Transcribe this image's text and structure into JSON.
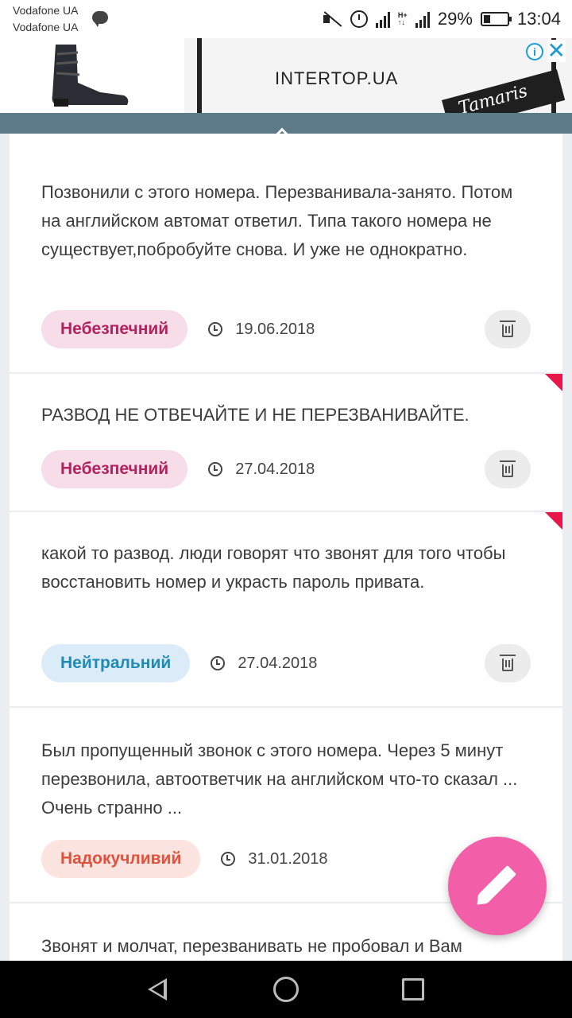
{
  "status_bar": {
    "carrier_1": "Vodafone UA",
    "carrier_2": "Vodafone UA",
    "battery": "29%",
    "time": "13:04",
    "icons": [
      "message-icon",
      "mute-icon",
      "alarm-icon",
      "signal-icon",
      "hplus-icon",
      "battery-icon"
    ]
  },
  "ad": {
    "brand": "INTERTOP.UA",
    "sub_brand": "Tamaris",
    "info_icon": "info-icon",
    "close_label": "✕"
  },
  "header": {
    "collapse_icon": "chevron-up-icon"
  },
  "reviews": [
    {
      "text": "Позвонили с этого номера. Перезванивала-занято. Потом на английском автомат ответил. Типа такого номера не существует,побробуйте снова. И уже не однократно.",
      "badge": "Небезпечний",
      "badge_type": "danger",
      "date": "19.06.2018",
      "flag": false
    },
    {
      "text": "РАЗВОД НЕ ОТВЕЧАЙТЕ И НЕ ПЕРЕЗВАНИВАЙТЕ.",
      "badge": "Небезпечний",
      "badge_type": "danger",
      "date": "27.04.2018",
      "flag": true
    },
    {
      "text": "какой то развод. люди говорят что звонят для того чтобы восстановить номер и украсть пароль привата.",
      "badge": "Нейтральний",
      "badge_type": "neutral",
      "date": "27.04.2018",
      "flag": true
    },
    {
      "text": "Был пропущенный звонок с этого номера. Через 5 минут перезвонила, автоответчик на английском что-то сказал ... Очень странно ...",
      "badge": "Надокучливий",
      "badge_type": "annoy",
      "date": "31.01.2018",
      "flag": false
    },
    {
      "text": "Звонят и молчат, перезванивать не пробовал и Вам",
      "badge": "",
      "badge_type": "",
      "date": "",
      "flag": false
    }
  ],
  "colors": {
    "header": "#5c7a87",
    "fab": "#f25ea8",
    "danger": "#b0235e",
    "neutral": "#1f8bb4",
    "annoy": "#e0523b",
    "flag": "#e8174a"
  },
  "fab": {
    "icon": "pencil-icon"
  },
  "nav": {
    "back_icon": "back-icon",
    "home_icon": "home-icon",
    "recent_icon": "recent-apps-icon"
  }
}
